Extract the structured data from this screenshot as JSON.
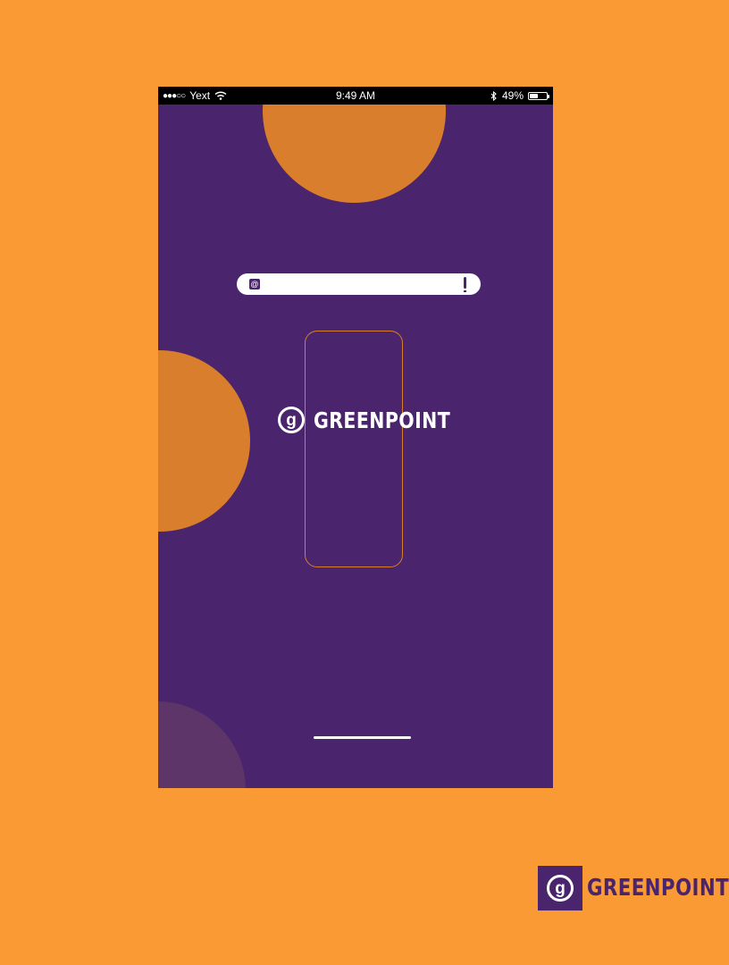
{
  "status_bar": {
    "signal": "●●●○○",
    "carrier": "Yext",
    "wifi_icon": "wifi-icon",
    "time": "9:49 AM",
    "bluetooth_icon": "bluetooth-icon",
    "battery_percent": "49%",
    "battery_level": 0.49
  },
  "search": {
    "logo_glyph": "@",
    "mark_icon": "exclamation-icon"
  },
  "brand": {
    "icon_glyph": "g",
    "name": "GREENPOINT"
  },
  "corner_brand": {
    "icon_glyph": "g",
    "name": "GREENPOINT"
  },
  "colors": {
    "background": "#FA9A35",
    "screen": "#4A246C",
    "accent": "#D97E2C",
    "muted_circle": "#5E3568"
  }
}
